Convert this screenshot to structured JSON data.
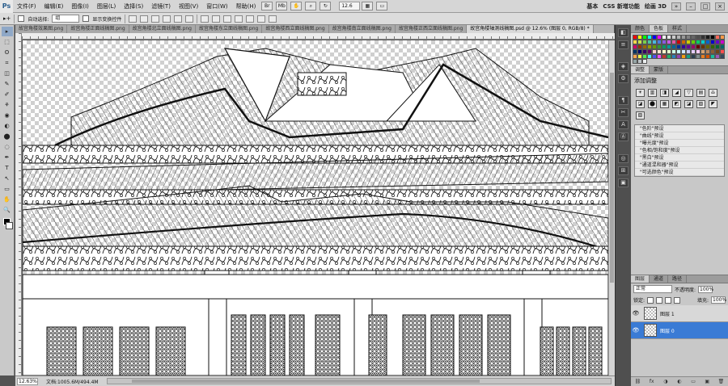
{
  "app": {
    "logo": "Ps"
  },
  "menu": [
    "文件(F)",
    "编辑(E)",
    "图像(I)",
    "图层(L)",
    "选择(S)",
    "滤镜(T)",
    "视图(V)",
    "窗口(W)",
    "帮助(H)"
  ],
  "menubar_tools": {
    "zoom": "12.6"
  },
  "workspaces": [
    "基本",
    "CSS 新增功能",
    "绘画 3D"
  ],
  "window_buttons": [
    "»",
    "–",
    "□",
    "×"
  ],
  "options": {
    "tool_glyph": "▸+",
    "auto_select_label": "自动选择:",
    "auto_select_value": "组",
    "show_transform_label": "显示变换控件"
  },
  "doc_tabs": [
    "故宫角楼效果图.png",
    "故宫角楼正面线稿图.png",
    "故宫角楼北立面线稿图.png",
    "故宫角楼东立面线稿图.png",
    "故宫角楼西立面线稿图.png",
    "故宫角楼南立面线稿图.png",
    "故宫角楼正西立面线稿图.png",
    "故宫角楼轴测线稿图.psd @ 12.6% (图层 0, RGB/8) *"
  ],
  "active_tab_index": 7,
  "tools": [
    "▸",
    "⬚",
    "ʘ",
    "⌗",
    "◫",
    "✎",
    "✐",
    "⚘",
    "◉",
    "◐",
    "⬤",
    "◌",
    "✒",
    "T",
    "↖",
    "▭",
    "✋",
    "🔍"
  ],
  "status": {
    "zoom": "12.63%",
    "doc": "文档:1005.6M/494.4M"
  },
  "dock_icons": [
    "◧",
    "≡",
    "◈",
    "⚙",
    "¶",
    "✂",
    "A",
    "Ⓐ",
    "◎",
    "⊞",
    "▣"
  ],
  "panels": {
    "swatch_tabs": [
      "颜色",
      "色板",
      "样式"
    ],
    "adjust_tabs": [
      "调整",
      "蒙版"
    ],
    "adjust_title": "添加调整",
    "adjust_icons_row1": [
      "☀",
      "▥",
      "◨",
      "◢"
    ],
    "adjust_icons_row2": [
      "▽",
      "▤",
      "♎",
      "◪",
      "⬤",
      "▦"
    ],
    "adjust_icons_row3": [
      "◩",
      "◪",
      "▨",
      "◤",
      "▧"
    ],
    "presets": [
      "\"色阶\"预设",
      "\"曲线\"预设",
      "\"曝光度\"预设",
      "\"色相/饱和度\"预设",
      "\"黑白\"预设",
      "\"通道混和器\"预设",
      "\"可选颜色\"预设"
    ],
    "layer_tabs": [
      "图层",
      "通道",
      "路径"
    ],
    "blend_mode": "正常",
    "opacity_label": "不透明度:",
    "opacity_value": "100%",
    "lock_label": "锁定:",
    "fill_label": "填充:",
    "fill_value": "100%",
    "layers": [
      {
        "name": "图层 1",
        "selected": false
      },
      {
        "name": "图层 0",
        "selected": true
      }
    ],
    "layer_footer": [
      "⛓",
      "fx",
      "◑",
      "◐",
      "▭",
      "▣",
      "🗑"
    ]
  },
  "colors": {
    "selection": "#3a7bd5",
    "swatches": [
      "#ff0000",
      "#ffff00",
      "#00ff00",
      "#00ffff",
      "#0000ff",
      "#ff00ff",
      "#ffffff",
      "#e6e6e6",
      "#cccccc",
      "#b3b3b3",
      "#999999",
      "#808080",
      "#666666",
      "#4d4d4d",
      "#333333",
      "#1a1a1a",
      "#000000",
      "#ff6a5b",
      "#ff9a4a",
      "#ffd84a",
      "#c8e44a",
      "#7ad04a",
      "#4ac8a0",
      "#4ab8e0",
      "#4a7ae0",
      "#8a5ae0",
      "#c85ae0",
      "#e05aa0",
      "#cc0000",
      "#cc6600",
      "#cccc00",
      "#66cc00",
      "#00cc66",
      "#00cccc",
      "#0066cc",
      "#0000cc",
      "#6600cc",
      "#cc00cc",
      "#cc0066",
      "#993300",
      "#996600",
      "#999900",
      "#669900",
      "#339933",
      "#009966",
      "#009999",
      "#006699",
      "#003399",
      "#330099",
      "#660099",
      "#990066",
      "#660000",
      "#663300",
      "#666600",
      "#336600",
      "#006633",
      "#006666",
      "#003366",
      "#000066",
      "#330066",
      "#660066",
      "#ffcccc",
      "#ffe5cc",
      "#ffffcc",
      "#e5ffcc",
      "#ccffe5",
      "#ccffff",
      "#cce5ff",
      "#ccccff",
      "#e5ccff",
      "#ffccff",
      "#d4a373",
      "#bc8a5f",
      "#8b5e34",
      "#6f4518",
      "#ff4f4f",
      "#ffa64f",
      "#f0f04f",
      "#4ff04f",
      "#4ff0f0",
      "#4f4ff0",
      "#f04ff0",
      "#c0392b",
      "#27ae60",
      "#2980b9",
      "#8e44ad",
      "#f39c12",
      "#16a085",
      "#2c3e50",
      "#7f8c8d",
      "#e67e22",
      "#d35400",
      "#1abc9c",
      "#9b59b6",
      "#34495e",
      "#95a5a6",
      "#bdc3c7",
      "#ecf0f1"
    ]
  }
}
